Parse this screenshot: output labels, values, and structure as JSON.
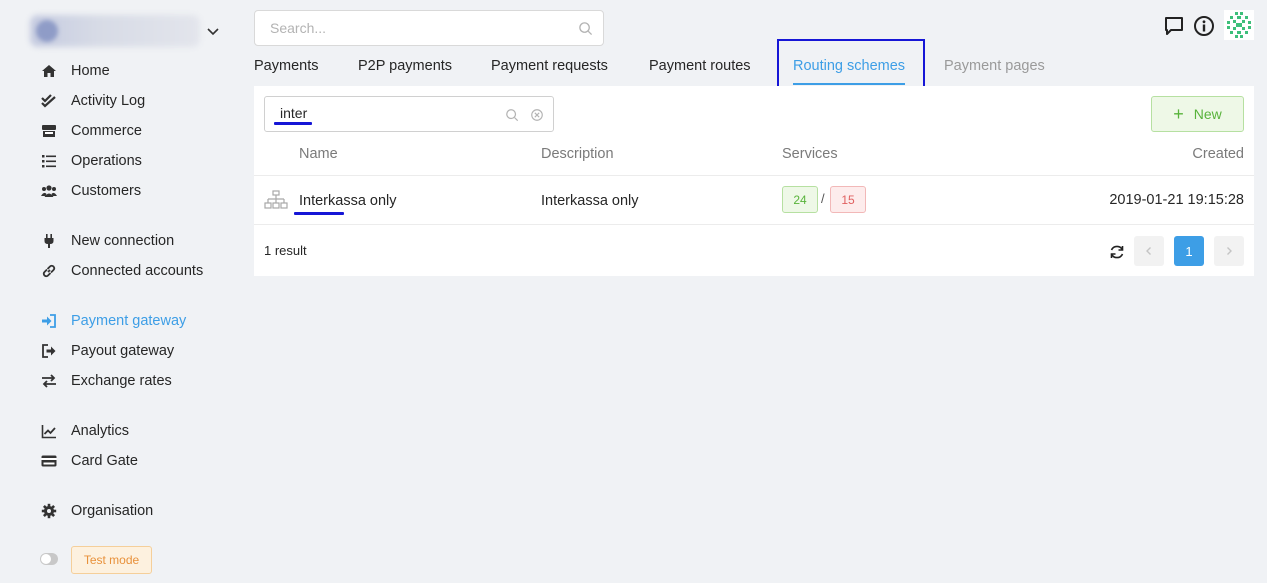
{
  "header": {
    "search_placeholder": "Search..."
  },
  "sidebar": {
    "items": [
      {
        "label": "Home"
      },
      {
        "label": "Activity Log"
      },
      {
        "label": "Commerce"
      },
      {
        "label": "Operations"
      },
      {
        "label": "Customers"
      },
      {
        "label": "New connection"
      },
      {
        "label": "Connected accounts"
      },
      {
        "label": "Payment gateway",
        "active": true
      },
      {
        "label": "Payout gateway"
      },
      {
        "label": "Exchange rates"
      },
      {
        "label": "Analytics"
      },
      {
        "label": "Card Gate"
      },
      {
        "label": "Organisation"
      }
    ],
    "test_mode_label": "Test mode"
  },
  "tabs": [
    {
      "label": "Payments"
    },
    {
      "label": "P2P payments"
    },
    {
      "label": "Payment requests"
    },
    {
      "label": "Payment routes"
    },
    {
      "label": "Routing schemes",
      "active": true
    },
    {
      "label": "Payment pages",
      "disabled": true
    }
  ],
  "toolbar": {
    "filter_value": "inter",
    "new_label": "New"
  },
  "table": {
    "columns": [
      "Name",
      "Description",
      "Services",
      "Created"
    ],
    "rows": [
      {
        "name": "Interkassa only",
        "description": "Interkassa only",
        "services_enabled": "24",
        "services_disabled": "15",
        "separator": "/",
        "created": "2019-01-21 19:15:28"
      }
    ]
  },
  "footer": {
    "result_text": "1 result",
    "current_page": "1"
  },
  "colors": {
    "accent": "#3d9ee6",
    "annotation": "#1616d6",
    "success": "#58b33b",
    "danger": "#e06060",
    "warning": "#e8913b"
  }
}
